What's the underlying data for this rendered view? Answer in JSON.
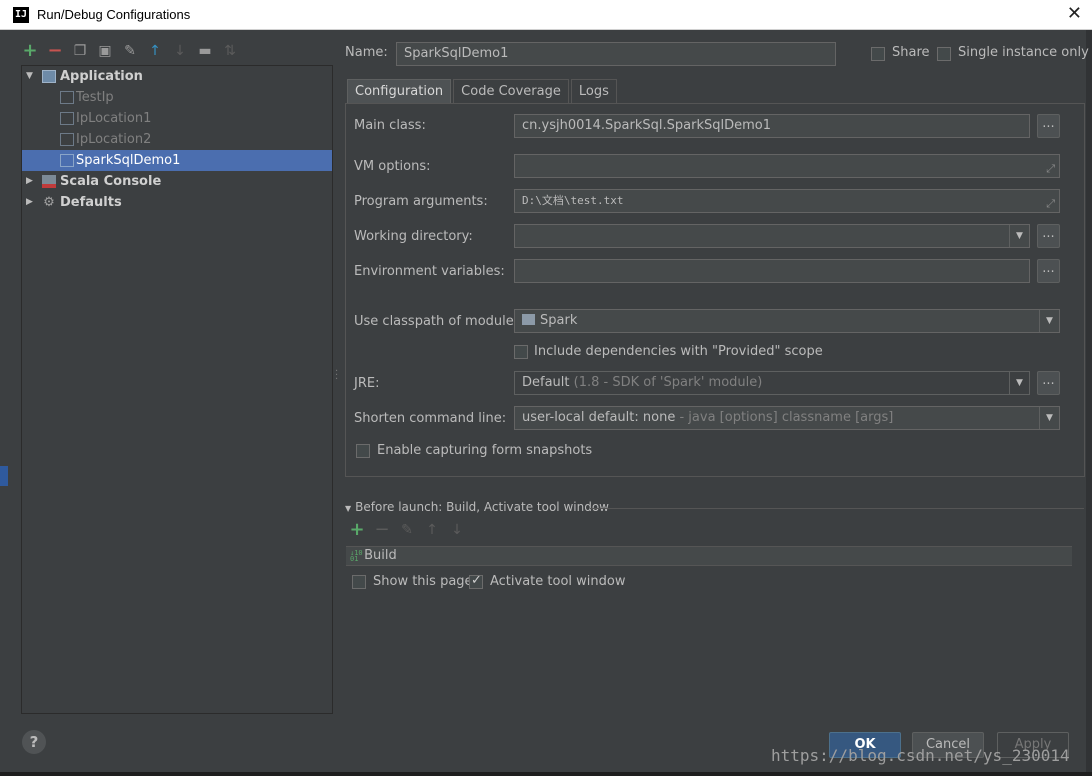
{
  "window": {
    "title": "Run/Debug Configurations",
    "app_icon": "IJ"
  },
  "toolbar": {
    "icons": [
      "add-icon",
      "remove-icon",
      "copy-icon",
      "save-icon",
      "edit-defaults-icon",
      "move-up-icon",
      "move-down-icon",
      "folder-icon",
      "sort-icon"
    ]
  },
  "tree": {
    "application": "Application",
    "children": [
      "TestIp",
      "IpLocation1",
      "IpLocation2",
      "SparkSqlDemo1"
    ],
    "scala_console": "Scala Console",
    "defaults": "Defaults"
  },
  "form": {
    "name_label": "Name:",
    "name_value": "SparkSqlDemo1",
    "share_label": "Share",
    "single_instance_label": "Single instance only",
    "tabs": [
      "Configuration",
      "Code Coverage",
      "Logs"
    ],
    "main_class_label": "Main class:",
    "main_class_value": "cn.ysjh0014.SparkSql.SparkSqlDemo1",
    "vm_options_label": "VM options:",
    "vm_options_value": "",
    "program_args_label": "Program arguments:",
    "program_args_value": "D:\\文档\\test.txt",
    "working_dir_label": "Working directory:",
    "working_dir_value": "",
    "env_vars_label": "Environment variables:",
    "env_vars_value": "",
    "classpath_label": "Use classpath of module:",
    "classpath_value": "Spark",
    "include_deps_label": "Include dependencies with \"Provided\" scope",
    "include_deps_checked": false,
    "jre_label": "JRE:",
    "jre_value": "Default",
    "jre_hint": "(1.8 - SDK of 'Spark' module)",
    "shorten_label": "Shorten command line:",
    "shorten_value": "user-local default: none",
    "shorten_hint": "- java [options] classname [args]",
    "snapshots_label": "Enable capturing form snapshots",
    "snapshots_checked": false,
    "dots": "..."
  },
  "before_launch": {
    "title": "Before launch: Build, Activate tool window",
    "items": [
      "Build"
    ],
    "show_page_label": "Show this page",
    "show_page_checked": false,
    "activate_label": "Activate tool window",
    "activate_checked": true
  },
  "buttons": {
    "ok": "OK",
    "cancel": "Cancel",
    "apply": "Apply",
    "help": "?"
  },
  "watermark": "https://blog.csdn.net/ys_230014"
}
